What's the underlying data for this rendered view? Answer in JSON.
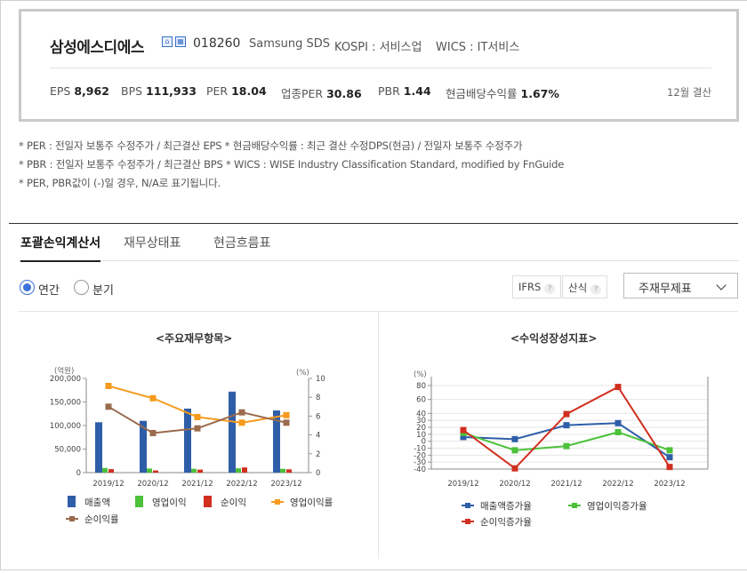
{
  "company": {
    "name": "삼성에스디에스",
    "code": "018260",
    "english": "Samsung SDS",
    "market": "KOSPI : 서비스업",
    "wics": "WICS : IT서비스"
  },
  "metrics": [
    {
      "label": "EPS",
      "value": "8,962"
    },
    {
      "label": "BPS",
      "value": "111,933"
    },
    {
      "label": "PER",
      "value": "18.04"
    },
    {
      "label": "업종PER",
      "value": "30.86"
    },
    {
      "label": "PBR",
      "value": "1.44"
    },
    {
      "label": "현금배당수익률",
      "value": "1.67%"
    }
  ],
  "fiscal_close": "12월 결산",
  "notes": [
    "* PER : 전일자 보통주 수정주가 / 최근결산 EPS * 현금배당수익률 : 최근 결산 수정DPS(현금) / 전일자 보통주 수정주가",
    "* PBR : 전일자 보통주 수정주가 / 최근결산 BPS * WICS : WISE Industry Classification Standard, modified by FnGuide",
    "* PER, PBR값이 (-)일 경우, N/A로 표기됩니다."
  ],
  "tabs": [
    "포괄손익계산서",
    "재무상태표",
    "현금흐름표"
  ],
  "period": {
    "annual": "연간",
    "quarter": "분기"
  },
  "toggles": {
    "ifrs": "IFRS",
    "calc": "산식",
    "q": "?"
  },
  "select": {
    "value": "주재무제표"
  },
  "chart_data": [
    {
      "type": "bar",
      "title": "<주요재무항목>",
      "categories": [
        "2019/12",
        "2020/12",
        "2021/12",
        "2022/12",
        "2023/12"
      ],
      "left_axis": {
        "label": "(억원)",
        "ylim": [
          0,
          200000
        ],
        "ticks": [
          "0",
          "50,000",
          "100,000",
          "150,000",
          "200,000"
        ]
      },
      "right_axis": {
        "label": "(%)",
        "ylim": [
          0,
          10
        ],
        "ticks": [
          "0",
          "2",
          "4",
          "6",
          "8",
          "10"
        ]
      },
      "series": [
        {
          "name": "매출액",
          "kind": "bar",
          "axis": "left",
          "color": "#2e5ea8",
          "values": [
            107000,
            110000,
            136000,
            172000,
            132000
          ]
        },
        {
          "name": "영업이익",
          "kind": "bar",
          "axis": "left",
          "color": "#4cc13a",
          "values": [
            9900,
            8700,
            8100,
            9200,
            8100
          ]
        },
        {
          "name": "순이익",
          "kind": "bar",
          "axis": "left",
          "color": "#d12f1f",
          "values": [
            7400,
            4600,
            6400,
            11000,
            7000
          ]
        },
        {
          "name": "영업이익률",
          "kind": "line",
          "axis": "right",
          "color": "#f59a1c",
          "values": [
            9.2,
            7.9,
            5.9,
            5.3,
            6.1
          ]
        },
        {
          "name": "순이익률",
          "kind": "line",
          "axis": "right",
          "color": "#9a6b4d",
          "values": [
            7.0,
            4.2,
            4.7,
            6.4,
            5.3
          ]
        }
      ]
    },
    {
      "type": "line",
      "title": "<수익성장성지표>",
      "categories": [
        "2019/12",
        "2020/12",
        "2021/12",
        "2022/12",
        "2023/12"
      ],
      "axis": {
        "label": "(%)",
        "ylim": [
          -40,
          80
        ],
        "ticks": [
          "-40",
          "-30",
          "-20",
          "-10",
          "0",
          "10",
          "20",
          "30",
          "40",
          "60",
          "80"
        ]
      },
      "series": [
        {
          "name": "매출액증가율",
          "color": "#2e5ea8",
          "values": [
            6,
            3,
            23,
            26,
            -23
          ]
        },
        {
          "name": "영업이익증가율",
          "color": "#4cc13a",
          "values": [
            12,
            -13,
            -7,
            13,
            -13
          ]
        },
        {
          "name": "순이익증가율",
          "color": "#d12f1f",
          "values": [
            16,
            -39,
            39,
            78,
            -37
          ]
        }
      ]
    }
  ]
}
